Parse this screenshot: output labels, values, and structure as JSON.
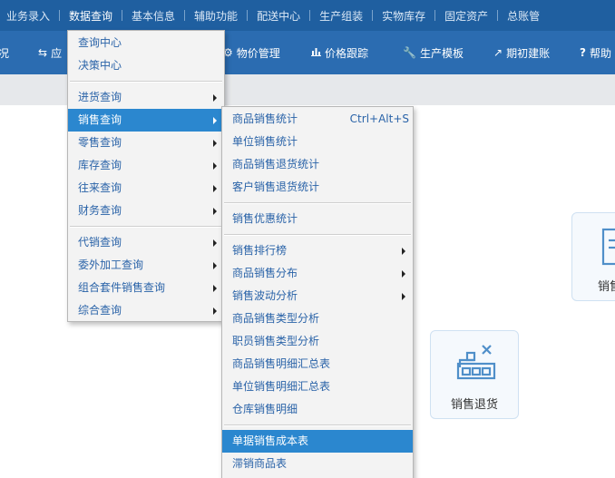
{
  "top_nav": {
    "items": [
      "业务录入",
      "数据查询",
      "基本信息",
      "辅助功能",
      "配送中心",
      "生产组装",
      "实物库存",
      "固定资产",
      "总账管"
    ],
    "active": "数据查询"
  },
  "toolbar": {
    "items": [
      {
        "icon": "",
        "label": "况"
      },
      {
        "icon": "⇆",
        "label": "应"
      },
      {
        "icon": "⚙",
        "label": "物价管理"
      },
      {
        "icon": "📊",
        "label": "价格跟踪"
      },
      {
        "icon": "🔧",
        "label": "生产模板"
      },
      {
        "icon": "↗",
        "label": "期初建账"
      },
      {
        "icon": "?",
        "label": "帮助"
      }
    ]
  },
  "menu_main": {
    "group1": [
      "查询中心",
      "决策中心"
    ],
    "group2": [
      "进货查询",
      "销售查询",
      "零售查询",
      "库存查询",
      "往来查询",
      "财务查询"
    ],
    "group3": [
      "代销查询",
      "委外加工查询",
      "组合套件销售查询",
      "综合查询"
    ],
    "highlighted": "销售查询"
  },
  "menu_sub": {
    "group1": [
      {
        "label": "商品销售统计",
        "shortcut": "Ctrl+Alt+S"
      },
      {
        "label": "单位销售统计"
      },
      {
        "label": "商品销售退货统计"
      },
      {
        "label": "客户销售退货统计"
      }
    ],
    "group2": [
      {
        "label": "销售优惠统计"
      }
    ],
    "group3": [
      {
        "label": "销售排行榜",
        "submenu": true
      },
      {
        "label": "商品销售分布",
        "submenu": true
      },
      {
        "label": "销售波动分析",
        "submenu": true
      },
      {
        "label": "商品销售类型分析"
      },
      {
        "label": "职员销售类型分析"
      },
      {
        "label": "商品销售明细汇总表"
      },
      {
        "label": "单位销售明细汇总表"
      },
      {
        "label": "仓库销售明细"
      }
    ],
    "group4": [
      {
        "label": "单据销售成本表"
      },
      {
        "label": "滞销商品表"
      }
    ],
    "highlighted": "单据销售成本表"
  },
  "cards": {
    "sales_return": "销售退货",
    "partial_right": "销售"
  },
  "colors": {
    "topbar_bg": "#1f5fa0",
    "toolbar_bg": "#2b6cb1",
    "menu_text": "#2a63a8",
    "highlight": "#2b87cf",
    "icon_blue": "#4f8fc9"
  }
}
